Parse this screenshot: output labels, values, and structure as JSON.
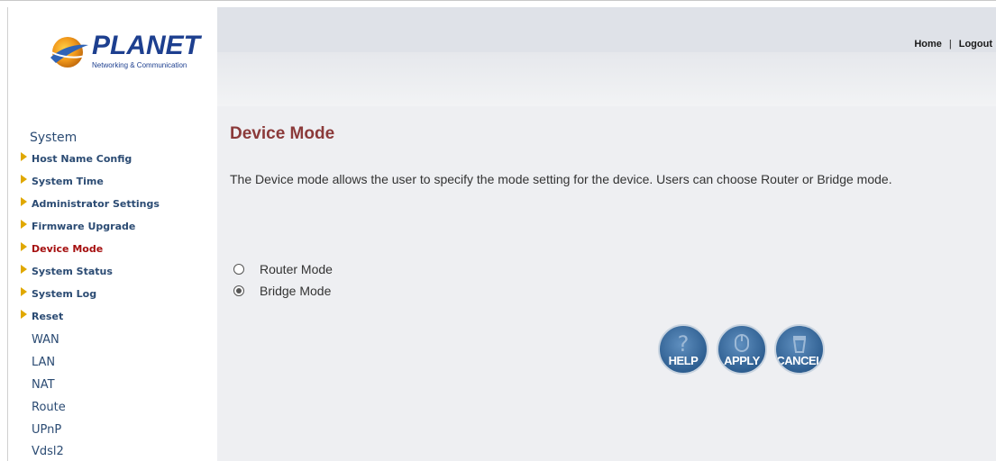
{
  "brand": {
    "name": "PLANET",
    "tagline": "Networking & Communication"
  },
  "header": {
    "home": "Home",
    "separator": "|",
    "logout": "Logout"
  },
  "sidebar": {
    "section": "System",
    "sub_items": [
      {
        "label": "Host Name Config"
      },
      {
        "label": "System Time"
      },
      {
        "label": "Administrator Settings"
      },
      {
        "label": "Firmware Upgrade"
      },
      {
        "label": "Device Mode",
        "active": true
      },
      {
        "label": "System Status"
      },
      {
        "label": "System Log"
      },
      {
        "label": "Reset"
      }
    ],
    "main_items": [
      {
        "label": "WAN"
      },
      {
        "label": "LAN"
      },
      {
        "label": "NAT"
      },
      {
        "label": "Route"
      },
      {
        "label": "UPnP"
      },
      {
        "label": "Vdsl2"
      }
    ]
  },
  "main": {
    "title": "Device Mode",
    "description": "The Device mode allows the user to specify the mode setting for the device. Users can choose Router or Bridge mode.",
    "options": [
      {
        "label": "Router Mode",
        "checked": false
      },
      {
        "label": "Bridge Mode",
        "checked": true
      }
    ],
    "buttons": {
      "help": "HELP",
      "apply": "APPLY",
      "cancel": "CANCEL"
    }
  },
  "colors": {
    "active_menu": "#a50f0f",
    "menu_text": "#2b4b73",
    "title": "#8b3a3a",
    "arrow": "#e0a800",
    "content_bg": "#eeeff2"
  }
}
